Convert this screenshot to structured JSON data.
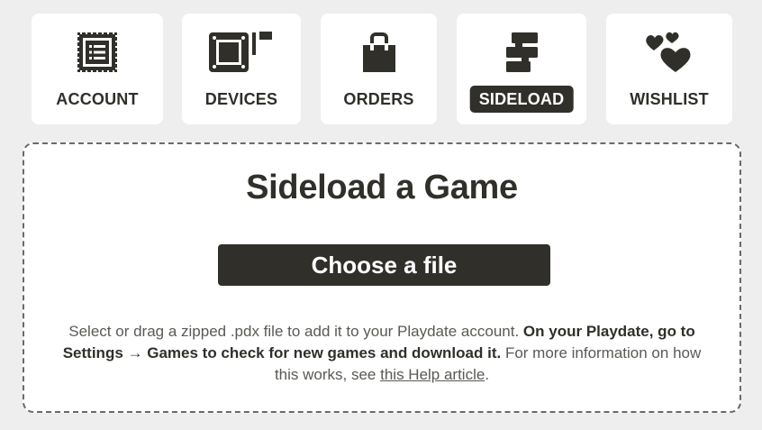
{
  "nav": {
    "tabs": [
      {
        "label": "ACCOUNT",
        "icon": "account-card-icon",
        "active": false
      },
      {
        "label": "DEVICES",
        "icon": "device-icon",
        "active": false
      },
      {
        "label": "ORDERS",
        "icon": "shopping-bag-icon",
        "active": false
      },
      {
        "label": "SIDELOAD",
        "icon": "sideload-icon",
        "active": true
      },
      {
        "label": "WISHLIST",
        "icon": "hearts-icon",
        "active": false
      }
    ]
  },
  "sideload": {
    "title": "Sideload a Game",
    "button_label": "Choose a file",
    "help_intro": "Select or drag a zipped .pdx file to add it to your Playdate account.",
    "help_bold": "On your Playdate, go to Settings → Games to check for new games and download it.",
    "help_more": "For more information on how this works, see",
    "help_link": "this Help article",
    "help_end": "."
  },
  "colors": {
    "background": "#eeeeee",
    "card": "#ffffff",
    "ink": "#302f2a",
    "muted_text": "#5a5954",
    "dashed_border": "#6b6a65"
  }
}
